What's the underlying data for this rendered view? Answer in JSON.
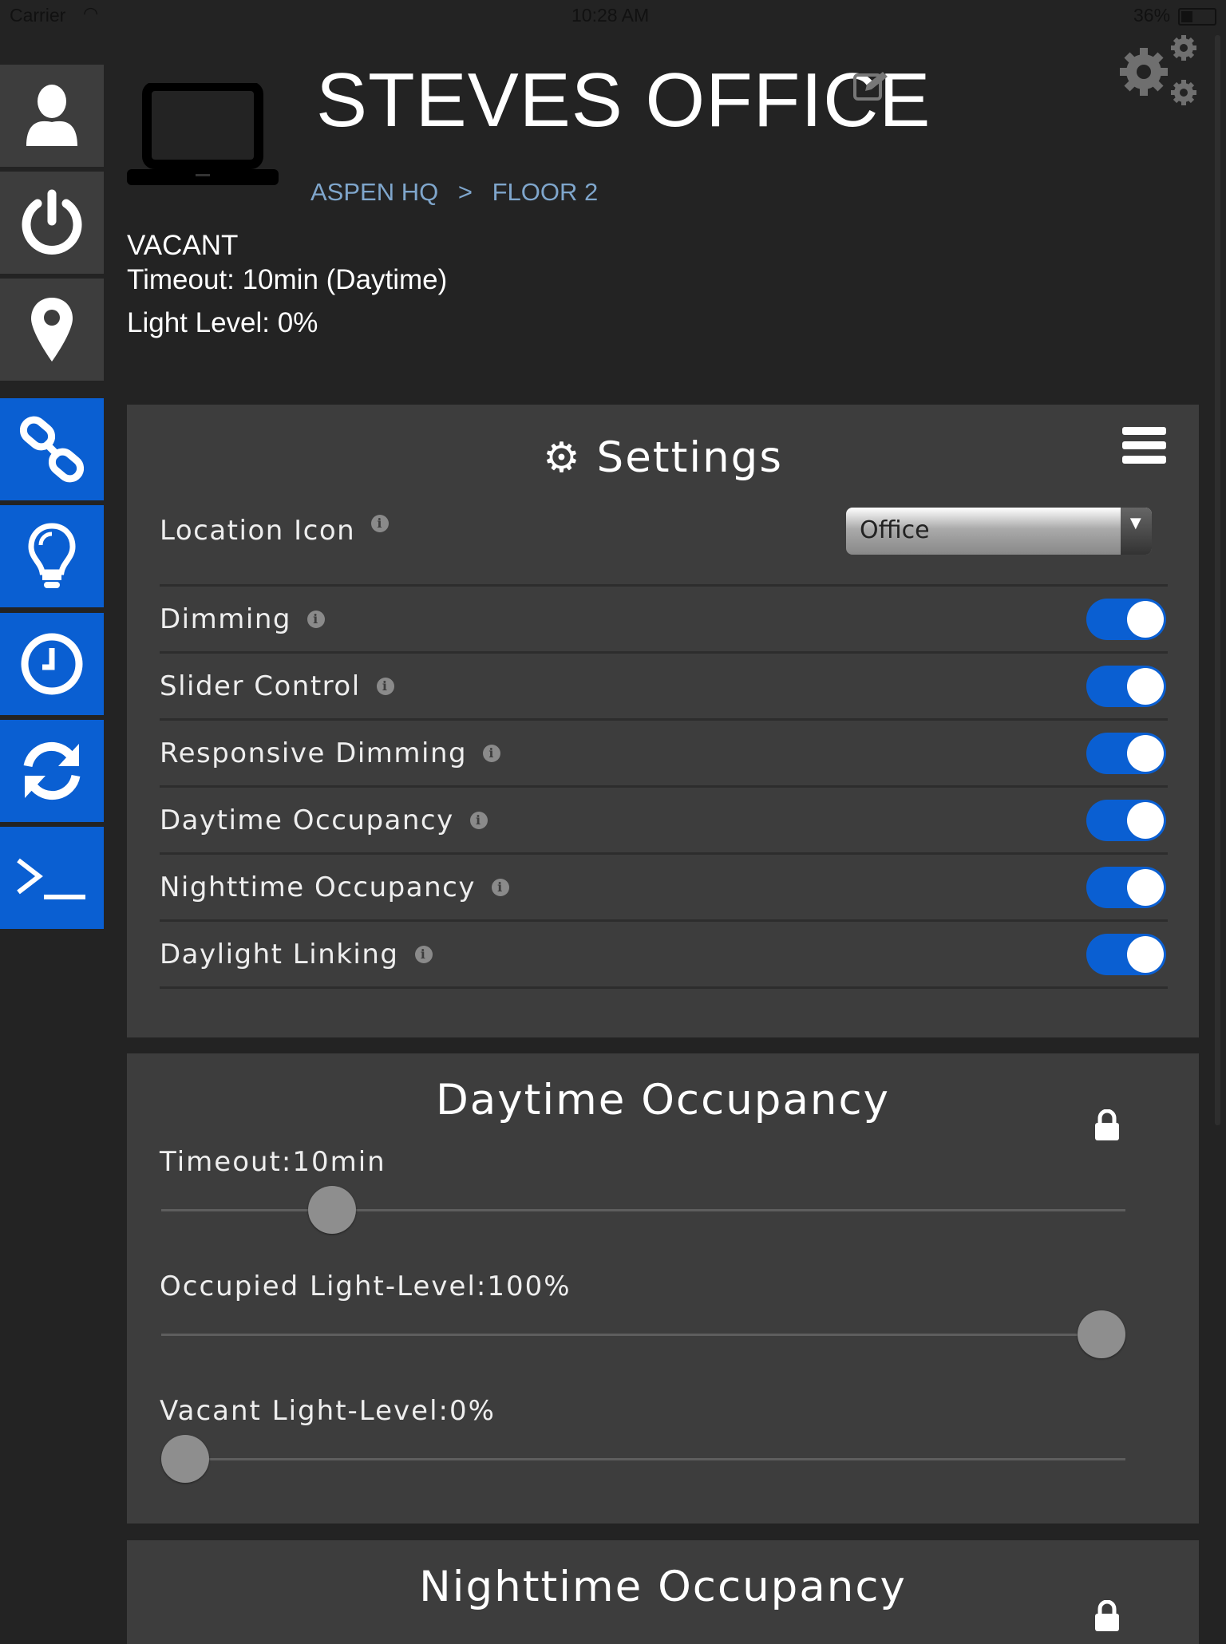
{
  "status_bar": {
    "carrier": "Carrier",
    "time": "10:28 AM",
    "battery": "36%"
  },
  "sidebar": {
    "items": [
      {
        "icon": "user-icon",
        "active": false
      },
      {
        "icon": "power-icon",
        "active": false
      },
      {
        "icon": "location-pin-icon",
        "active": false
      },
      {
        "icon": "link-icon",
        "active": true
      },
      {
        "icon": "lightbulb-icon",
        "active": true
      },
      {
        "icon": "clock-icon",
        "active": true
      },
      {
        "icon": "sync-icon",
        "active": true
      },
      {
        "icon": "terminal-icon",
        "active": true
      }
    ]
  },
  "header": {
    "title": "STEVES OFFICE",
    "breadcrumb": [
      "ASPEN HQ",
      ">",
      "FLOOR 2"
    ],
    "icon": "laptop-icon"
  },
  "state": {
    "status": "VACANT",
    "timeout": "Timeout: 10min (Daytime)",
    "light_level": "Light Level: 0%"
  },
  "settings": {
    "title": "Settings",
    "location_icon_label": "Location Icon",
    "location_icon_value": "Office",
    "toggles": [
      {
        "label": "Dimming",
        "on": true
      },
      {
        "label": "Slider Control",
        "on": true
      },
      {
        "label": "Responsive Dimming",
        "on": true
      },
      {
        "label": "Daytime Occupancy",
        "on": true
      },
      {
        "label": "Nighttime Occupancy",
        "on": true
      },
      {
        "label": "Daylight Linking",
        "on": true
      }
    ]
  },
  "daytime": {
    "title": "Daytime Occupancy",
    "sliders": [
      {
        "label": "Timeout:10min",
        "fraction": 0.16
      },
      {
        "label": "Occupied Light-Level:100%",
        "fraction": 1.0
      },
      {
        "label": "Vacant Light-Level:0%",
        "fraction": 0.0
      }
    ]
  },
  "nighttime": {
    "title": "Nighttime Occupancy"
  },
  "colors": {
    "accent": "#0a5fd2",
    "breadcrumb": "#7fa6cc",
    "panel": "#3d3d3d",
    "background": "#232323"
  }
}
